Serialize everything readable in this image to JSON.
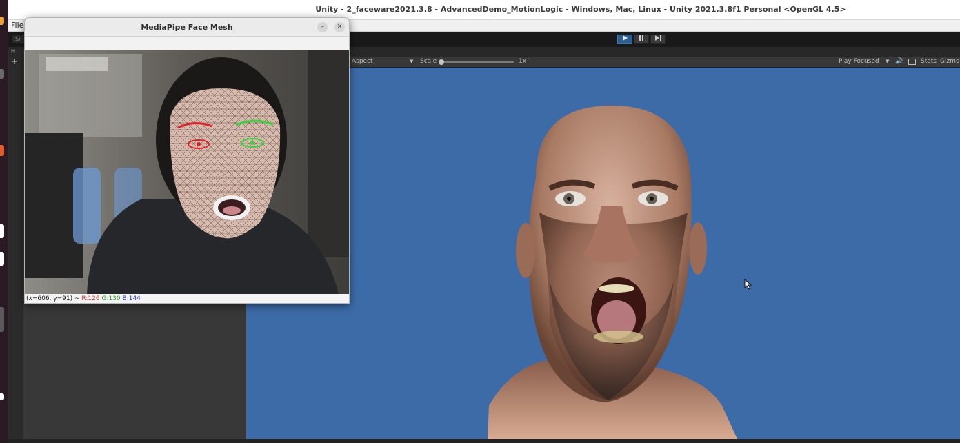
{
  "unity": {
    "window_title": "Unity - 2_faceware2021.3.8 - AdvancedDemo_MotionLogic - Windows, Mac, Linux - Unity 2021.3.8f1 Personal <OpenGL 4.5>",
    "menu": {
      "file": "File"
    },
    "toolbar": {
      "search_hint": "Si",
      "play_icon": "play-icon",
      "pause_icon": "pause-icon",
      "step_icon": "step-icon"
    },
    "hierarchy": {
      "tab_label": "H",
      "add_glyph": "+"
    }
  },
  "game_view": {
    "aspect_label": "Aspect",
    "scale_label": "Scale",
    "scale_value": "1x",
    "scale_level": 0.0,
    "play_focused": "Play Focused",
    "stats_label": "Stats",
    "gizmos_label": "Gizmos",
    "background_color": "#3d6ba8"
  },
  "mediapipe": {
    "window_title": "MediaPipe Face Mesh",
    "status": {
      "coords": "(x=606, y=91) ~",
      "r": "R:126",
      "g": "G:130",
      "b": "B:144"
    },
    "colors": {
      "left_eye": "#e0202a",
      "right_eye": "#3cd23c",
      "mesh": "#c8c8c8"
    }
  }
}
